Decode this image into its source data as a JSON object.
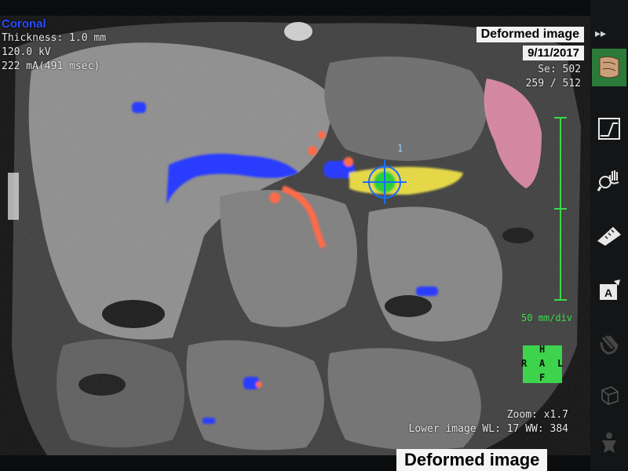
{
  "viewer": {
    "plane": "Coronal",
    "thickness": "Thickness: 1.0 mm",
    "kv": "120.0 kV",
    "ma": "222 mA(491 msec)",
    "image_title": "Deformed image",
    "date": "9/11/2017",
    "series": "Se: 502",
    "slice": "259 / 512",
    "scale": "50 mm/div",
    "zoom": "Zoom: x1.7",
    "window": "Lower image WL: 17  WW: 384",
    "marker_id": "1"
  },
  "orientation": {
    "top": "H",
    "left": "R",
    "center": "A",
    "right": "L",
    "bottom": "F"
  },
  "footer": {
    "label": "Deformed image"
  },
  "colors": {
    "overlay_blue": "#2a3cff",
    "overlay_red": "#ff6a4a",
    "overlay_yellow": "#e4d84a",
    "overlay_green": "#2ccf3c",
    "overlay_pink": "#f08cb0",
    "scale_green": "#39d94a",
    "crosshair": "#1a6cff",
    "active_tool": "#2c7a3a"
  },
  "toolbar": {
    "items": [
      {
        "name": "image-3d-icon",
        "active": true
      },
      {
        "name": "window-level-icon",
        "active": false
      },
      {
        "name": "zoom-pan-icon",
        "active": false
      },
      {
        "name": "measure-icon",
        "active": false
      },
      {
        "name": "annotate-icon",
        "active": false
      },
      {
        "name": "hand-icon",
        "active": false
      },
      {
        "name": "cube-icon",
        "active": false
      },
      {
        "name": "figure-icon",
        "active": false
      }
    ]
  }
}
